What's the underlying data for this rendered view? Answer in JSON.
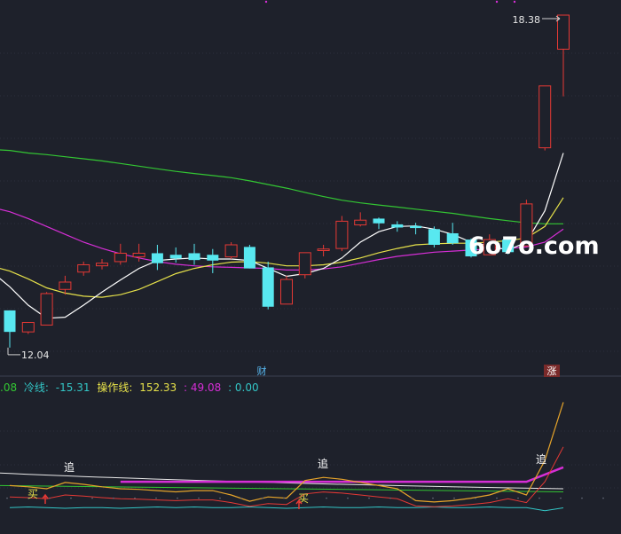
{
  "colors": {
    "bg": "#1e212b",
    "up": "#e53935",
    "down": "#58e8f0",
    "ma5": "#ffffff",
    "ma10": "#e6e14a",
    "ma20": "#d62ed6",
    "ma60": "#33c633",
    "grid": "#3a3f4f"
  },
  "markers": {
    "high_label": "18.38",
    "low_label": "12.04",
    "event_cai": "财",
    "event_zhang": "涨"
  },
  "watermark": "6o7o.com",
  "indicator_row": {
    "v0": ".08",
    "cold_label": "冷线:",
    "cold_value": "-15.31",
    "op_label": "操作线:",
    "op_value": "152.33",
    "v3": ": 49.08",
    "v4": ": 0.00"
  },
  "signals": {
    "buy": "买",
    "chase": "追"
  },
  "chart_data": [
    {
      "type": "candlestick",
      "ylim": [
        11.7,
        18.6
      ],
      "high": 18.38,
      "low": 12.04,
      "candles": [
        {
          "o": 12.75,
          "c": 12.34,
          "h": 12.75,
          "l": 12.04
        },
        {
          "o": 12.34,
          "c": 12.52,
          "h": 12.52,
          "l": 12.3
        },
        {
          "o": 12.47,
          "c": 13.07,
          "h": 13.1,
          "l": 12.47
        },
        {
          "o": 13.15,
          "c": 13.29,
          "h": 13.41,
          "l": 13.05
        },
        {
          "o": 13.48,
          "c": 13.62,
          "h": 13.68,
          "l": 13.41
        },
        {
          "o": 13.6,
          "c": 13.65,
          "h": 13.73,
          "l": 13.53
        },
        {
          "o": 13.68,
          "c": 13.84,
          "h": 14.02,
          "l": 13.62
        },
        {
          "o": 13.77,
          "c": 13.84,
          "h": 14.02,
          "l": 13.68
        },
        {
          "o": 13.84,
          "c": 13.65,
          "h": 14.0,
          "l": 13.52
        },
        {
          "o": 13.81,
          "c": 13.74,
          "h": 13.95,
          "l": 13.66
        },
        {
          "o": 13.84,
          "c": 13.71,
          "h": 14.02,
          "l": 13.62
        },
        {
          "o": 13.81,
          "c": 13.7,
          "h": 13.92,
          "l": 13.46
        },
        {
          "o": 13.77,
          "c": 14.0,
          "h": 14.05,
          "l": 13.73
        },
        {
          "o": 13.96,
          "c": 13.55,
          "h": 14.0,
          "l": 13.55
        },
        {
          "o": 13.57,
          "c": 12.82,
          "h": 13.68,
          "l": 12.77
        },
        {
          "o": 12.87,
          "c": 13.34,
          "h": 13.41,
          "l": 12.87
        },
        {
          "o": 13.43,
          "c": 13.85,
          "h": 13.85,
          "l": 13.36
        },
        {
          "o": 13.89,
          "c": 13.92,
          "h": 14.0,
          "l": 13.78
        },
        {
          "o": 13.93,
          "c": 14.45,
          "h": 14.55,
          "l": 13.88
        },
        {
          "o": 14.38,
          "c": 14.47,
          "h": 14.62,
          "l": 14.35
        },
        {
          "o": 14.5,
          "c": 14.41,
          "h": 14.52,
          "l": 14.3
        },
        {
          "o": 14.39,
          "c": 14.33,
          "h": 14.45,
          "l": 14.25
        },
        {
          "o": 14.36,
          "c": 14.32,
          "h": 14.42,
          "l": 14.2
        },
        {
          "o": 14.3,
          "c": 14.0,
          "h": 14.35,
          "l": 13.95
        },
        {
          "o": 14.22,
          "c": 14.03,
          "h": 14.42,
          "l": 14.0
        },
        {
          "o": 14.1,
          "c": 13.78,
          "h": 14.12,
          "l": 13.76
        },
        {
          "o": 13.81,
          "c": 14.1,
          "h": 14.2,
          "l": 13.8
        },
        {
          "o": 14.1,
          "c": 13.86,
          "h": 14.14,
          "l": 13.82
        },
        {
          "o": 13.98,
          "c": 14.78,
          "h": 14.86,
          "l": 13.97
        },
        {
          "o": 15.85,
          "c": 17.03,
          "h": 17.03,
          "l": 15.8
        },
        {
          "o": 17.73,
          "c": 18.38,
          "h": 18.38,
          "l": 16.83
        }
      ],
      "ma5": [
        13.2,
        12.85,
        12.6,
        12.62,
        12.85,
        13.1,
        13.33,
        13.55,
        13.7,
        13.73,
        13.75,
        13.73,
        13.73,
        13.7,
        13.55,
        13.4,
        13.45,
        13.55,
        13.75,
        14.05,
        14.25,
        14.35,
        14.36,
        14.3,
        14.2,
        14.05,
        13.98,
        13.9,
        14.05,
        14.65,
        15.75
      ],
      "ma10": [
        13.5,
        13.35,
        13.18,
        13.08,
        13.02,
        13.0,
        13.05,
        13.15,
        13.3,
        13.45,
        13.55,
        13.62,
        13.67,
        13.68,
        13.65,
        13.6,
        13.6,
        13.62,
        13.67,
        13.75,
        13.85,
        13.93,
        14.0,
        14.02,
        14.03,
        14.03,
        14.05,
        14.08,
        14.13,
        14.35,
        14.9
      ],
      "ma20": [
        14.63,
        14.5,
        14.35,
        14.2,
        14.05,
        13.93,
        13.83,
        13.75,
        13.68,
        13.63,
        13.6,
        13.58,
        13.57,
        13.56,
        13.55,
        13.52,
        13.52,
        13.54,
        13.58,
        13.65,
        13.72,
        13.78,
        13.82,
        13.86,
        13.88,
        13.9,
        13.92,
        13.93,
        13.96,
        14.05,
        14.3
      ],
      "ma60": [
        15.8,
        15.75,
        15.72,
        15.68,
        15.64,
        15.6,
        15.55,
        15.5,
        15.45,
        15.4,
        15.36,
        15.32,
        15.28,
        15.22,
        15.15,
        15.08,
        15.0,
        14.92,
        14.85,
        14.8,
        14.76,
        14.72,
        14.68,
        14.64,
        14.6,
        14.55,
        14.5,
        14.46,
        14.42,
        14.4,
        14.4
      ]
    },
    {
      "type": "line",
      "title": "",
      "ylim": [
        -40,
        160
      ],
      "series": [
        {
          "name": "操作线",
          "values": [
            20,
            18,
            15,
            25,
            22,
            18,
            15,
            14,
            12,
            10,
            12,
            12,
            5,
            -5,
            2,
            0,
            28,
            33,
            30,
            25,
            20,
            15,
            -4,
            -6,
            -4,
            0,
            5,
            15,
            5,
            60,
            152.33
          ]
        },
        {
          "name": "冷线",
          "values": [
            -15,
            -14,
            -15,
            -16,
            -15,
            -15,
            -16,
            -15,
            -14,
            -15,
            -14,
            -15,
            -15,
            -14,
            -15,
            -16,
            -15,
            -14,
            -15,
            -15,
            -14,
            -15,
            -15,
            -14,
            -15,
            -15,
            -14,
            -15,
            -15,
            -20,
            -15.31
          ]
        }
      ]
    }
  ]
}
